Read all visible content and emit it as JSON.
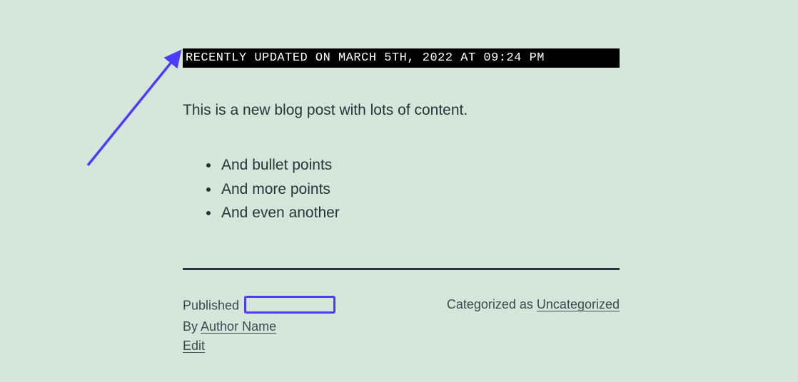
{
  "banner": {
    "text": "RECENTLY UPDATED ON MARCH 5TH, 2022 AT 09:24 PM"
  },
  "intro": "This is a new blog post with lots of content.",
  "bullets": [
    "And bullet points",
    "And more points",
    "And even another"
  ],
  "meta": {
    "published_label": "Published",
    "by_label": "By",
    "author_name": "Author Name",
    "edit_label": "Edit",
    "categorized_label": "Categorized as",
    "category": "Uncategorized"
  },
  "annotation": {
    "arrow_color": "#4b3cff"
  }
}
